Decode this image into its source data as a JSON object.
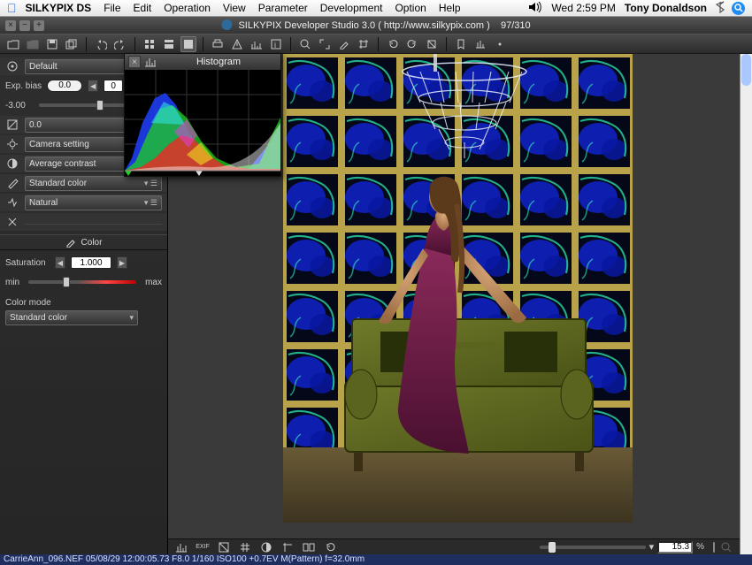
{
  "macbar": {
    "app": "SILKYPIX DS",
    "menus": [
      "File",
      "Edit",
      "Operation",
      "View",
      "Parameter",
      "Development",
      "Option",
      "Help"
    ],
    "clock": "Wed 2:59 PM",
    "user": "Tony Donaldson"
  },
  "window": {
    "title": "SILKYPIX Developer Studio 3.0 ( http://www.silkypix.com )",
    "counter": "97/310"
  },
  "histogram": {
    "title": "Histogram"
  },
  "left": {
    "preset": "Default",
    "exp_bias_label": "Exp. bias",
    "exp_bias_value": "0.0",
    "exp_bias_field": "0",
    "ev_scale_min": "-3.00",
    "contrast_value": "0.0",
    "wb_label": "Camera setting",
    "tone_label": "Average contrast",
    "color_label": "Standard color",
    "sharp_label": "Natural",
    "color_header": "Color",
    "saturation_label": "Saturation",
    "saturation_value": "1.000",
    "slider_min": "min",
    "slider_max": "max",
    "color_mode_label": "Color mode",
    "color_mode_value": "Standard color"
  },
  "zoom": {
    "value": "15.3",
    "pct": "%"
  },
  "status": "CarrieAnn_096.NEF 05/08/29 12:00:05.73 F8.0 1/160 ISO100 +0.7EV M(Pattern) f=32.0mm"
}
